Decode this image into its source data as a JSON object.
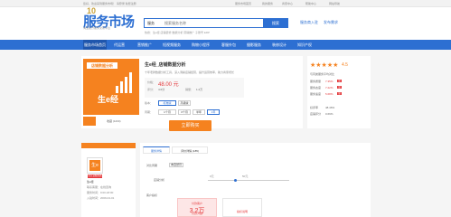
{
  "topbar": {
    "left": "您好，欢迎来到服务市场！  请登录  免费注册",
    "links": [
      "服务市场首页",
      "我的服务",
      "商家中心",
      "帮助中心",
      "网站导航"
    ]
  },
  "logo": {
    "ten": "10",
    "main": "服务市场",
    "sub": "淘宝官方服务交易平台"
  },
  "search": {
    "category": "服务",
    "placeholder": "搜索服务名称",
    "button": "搜索"
  },
  "hotwords": "热搜：生e经  店铺装修  数据分析  营销推广  子账号  ERP",
  "header_right": [
    "服务商入驻",
    "发布需求"
  ],
  "nav": {
    "items": [
      "服务市场首页",
      "代运营",
      "营销推广",
      "短视频服务",
      "购物小程序",
      "客服外包",
      "摄影服务",
      "装修设计",
      "知识产权"
    ],
    "active_index": 0
  },
  "product": {
    "image_banner": "店铺数据分析",
    "image_brand": "生e经",
    "title": "生e经_店铺数据分析",
    "desc": "十年老牌数据分析工具，深入洞察店铺经营，提升运营效率，助力商家增长",
    "price_label": "价格：",
    "price": "48.00 元",
    "rating_label": "评分：",
    "rating_value": "4.6分",
    "sales_label": "销量：",
    "sales_value": "1.2万",
    "version_label": "版本：",
    "versions": [
      "标准版",
      "高级版"
    ],
    "version_selected": 0,
    "period_label": "周期：",
    "periods": [
      "1个月",
      "3个月",
      "半年",
      "1年"
    ],
    "period_selected": 3,
    "buy_button": "立即购买",
    "favorite": "收藏 (1234)"
  },
  "rating": {
    "stars": "★★★★★",
    "stars_filled": 4.5,
    "score": "4.5",
    "title": "与同类服务平均对比",
    "rows": [
      {
        "label": "服务质量",
        "pct": "7.35%",
        "tag": "高"
      },
      {
        "label": "服务态度",
        "pct": "7.22%",
        "tag": "高"
      },
      {
        "label": "服务速度",
        "pct": "5.68%",
        "tag": "高"
      },
      {
        "label": "好评率",
        "pct": "48.46%",
        "tag": ""
      },
      {
        "label": "店铺评分",
        "pct": "0.69%",
        "tag": ""
      }
    ]
  },
  "seller": {
    "avatar_text": "生e",
    "verify": "已认证服务商",
    "name": "生e经",
    "info": [
      "联系客服：在线咨询",
      "服务时间：9:00-18:00",
      "入驻时间：2009-04-01"
    ]
  },
  "detail": {
    "tabs": [
      "服务详情",
      "评价详情 (185)"
    ],
    "active_tab": 0,
    "period_label": "对比周期",
    "period_value": "本自然月",
    "store_label": "店铺分析",
    "slider_left": "0元",
    "slider_right": "50元",
    "slider_level": 0.33,
    "customer_title": "客户指标",
    "cards": [
      {
        "title": "付款客户",
        "value": "3.2万",
        "sub": "付款人数"
      },
      {
        "title": "",
        "value": "",
        "sub": "指标说明"
      }
    ]
  }
}
